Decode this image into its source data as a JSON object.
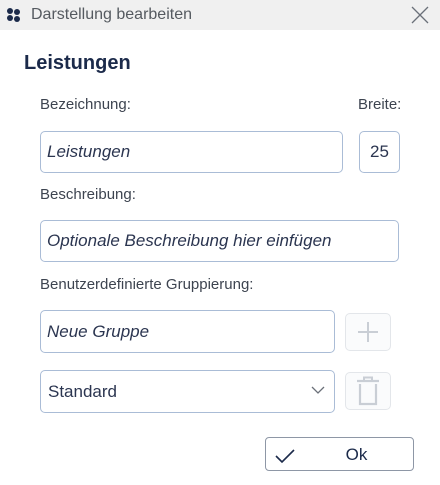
{
  "window": {
    "title": "Darstellung bearbeiten",
    "icon": "app-logo-icon",
    "close_icon": "close-icon"
  },
  "form": {
    "heading": "Leistungen",
    "name_label": "Bezeichnung:",
    "name_value": "Leistungen",
    "width_label": "Breite:",
    "width_value": "25",
    "description_label": "Beschreibung:",
    "description_placeholder": "Optionale Beschreibung hier einfügen",
    "grouping_label": "Benutzerdefinierte Gruppierung:",
    "new_group_placeholder": "Neue Gruppe",
    "add_icon": "plus-icon",
    "group_select_value": "Standard",
    "delete_icon": "trash-icon"
  },
  "footer": {
    "ok_label": "Ok",
    "ok_icon": "checkmark-icon"
  },
  "colors": {
    "heading": "#1b2a4a",
    "field_border": "#aabcd6",
    "titlebar_bg": "#f0f0f0"
  }
}
